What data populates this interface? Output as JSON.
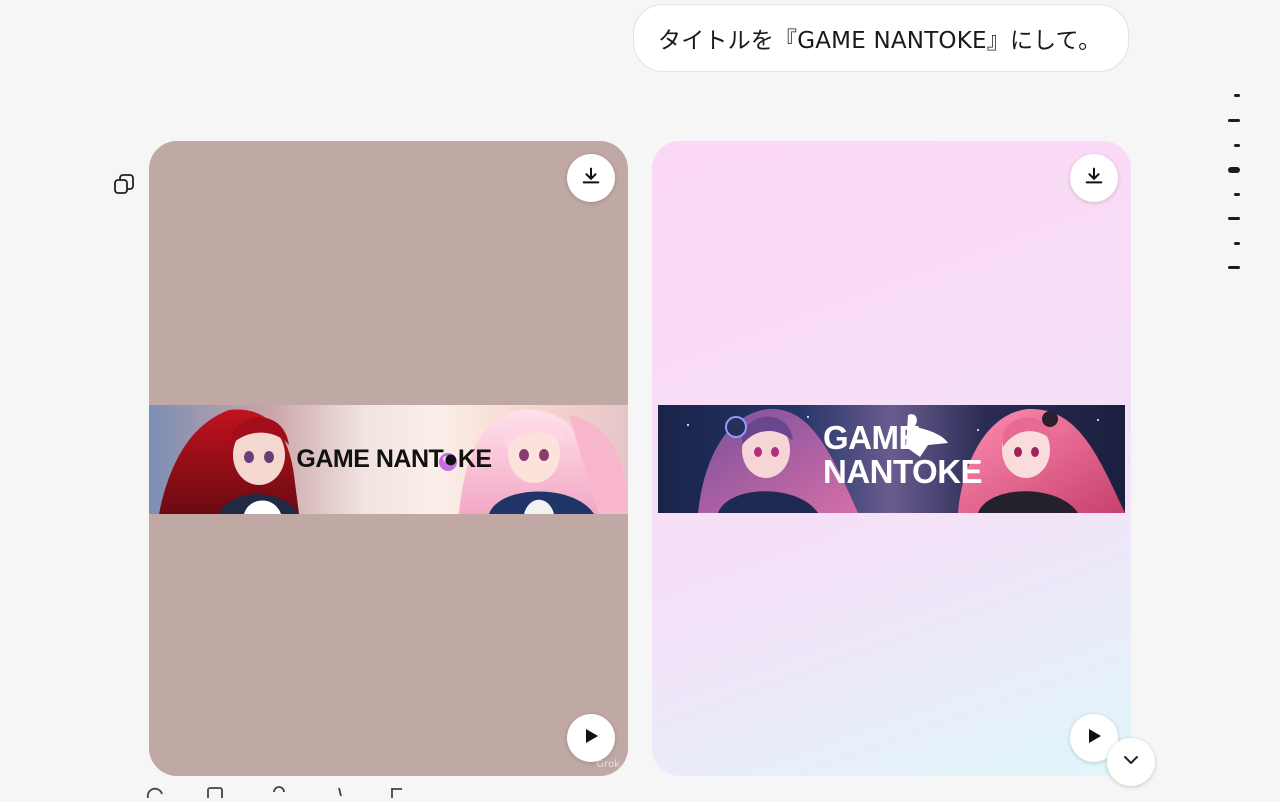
{
  "user_message": "タイトルを『GAME NANTOKE』にして。",
  "images": [
    {
      "banner_title": "GAME NANT●KE",
      "watermark": "Grok"
    },
    {
      "banner_title": "GAME NANTOKE"
    }
  ],
  "icons": {
    "copy": "copy-icon",
    "download": "download-icon",
    "play": "play-icon",
    "scroll_down": "chevron-down-icon"
  },
  "colors": {
    "page_bg": "#f7f6f6",
    "panel_1_bg": "#c0a8a4",
    "panel_2_bg": "#fbd8f6"
  }
}
